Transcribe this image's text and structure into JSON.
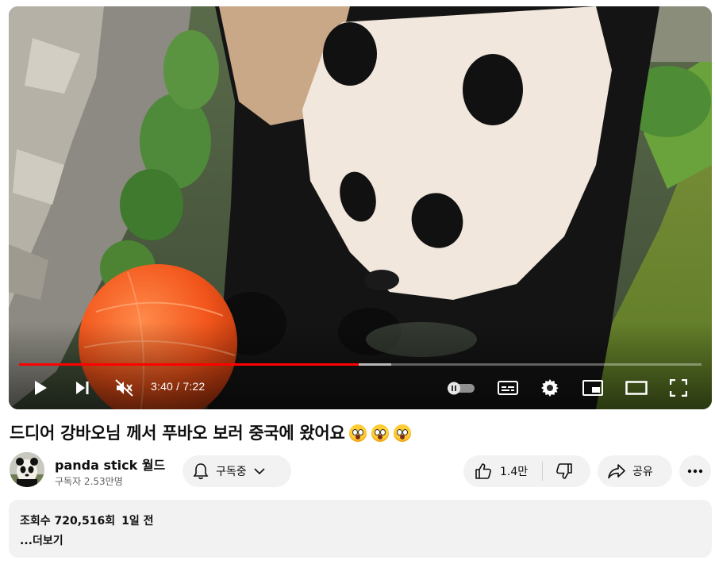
{
  "player": {
    "current_time": "3:40",
    "separator": " / ",
    "duration": "7:22",
    "progress_fraction": 0.498,
    "buffered_fraction": 0.545,
    "progress_color": "#ff0000",
    "muted": true,
    "autoplay_on": false
  },
  "video": {
    "title": "드디어 강바오님 께서 푸바오 보러 중국에 왔어요",
    "title_emojis": [
      "astonished-face",
      "astonished-face",
      "astonished-face"
    ]
  },
  "channel": {
    "name": "panda stick 월드",
    "subscribers": "구독자 2.53만명",
    "subscribe_label": "구독중"
  },
  "actions": {
    "likes": "1.4만",
    "share_label": "공유"
  },
  "description": {
    "views": "조회수 720,516회",
    "date": "1일 전",
    "more_label": "...더보기"
  },
  "colors": {
    "accent": "#ff0000",
    "pill_bg": "#f2f2f2",
    "text": "#0f0f0f",
    "secondary_text": "#606060"
  }
}
